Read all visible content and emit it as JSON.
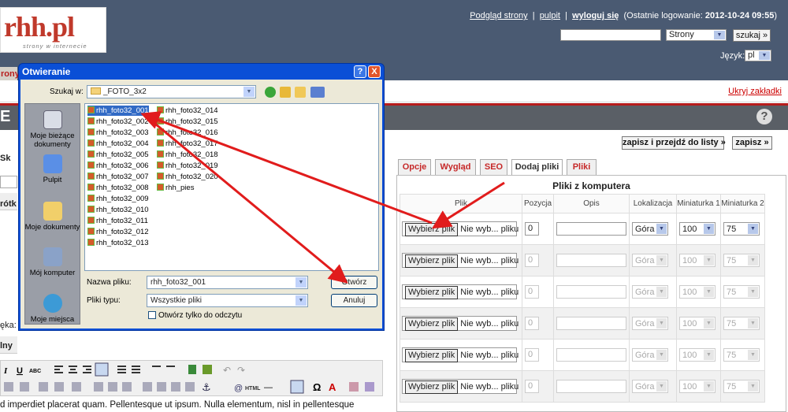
{
  "logo": {
    "text": "rhh.pl",
    "tagline": "strony w internecie"
  },
  "header": {
    "preview_link": "Podgląd strony",
    "desktop_link": "pulpit",
    "logout_link": "wyloguj się",
    "last_login_label": "(Ostatnie logowanie:",
    "last_login_value": "2012-10-24 09:55",
    "last_login_close": ")",
    "search_select": "Strony",
    "search_button": "szukaj »",
    "language_label": "Język:",
    "language_value": "pl",
    "separator": "|"
  },
  "nav": {
    "strony_tab": "rony",
    "hide_tabs": "Ukryj zakładki",
    "section_title": "E"
  },
  "actions": {
    "save_and_list": "zapisz i przejdź do listy »",
    "save": "zapisz »"
  },
  "tabs": [
    {
      "label": "Opcje",
      "active": false
    },
    {
      "label": "Wygląd",
      "active": false
    },
    {
      "label": "SEO",
      "active": false
    },
    {
      "label": "Dodaj pliki",
      "active": true
    },
    {
      "label": "Pliki",
      "active": false
    }
  ],
  "upload": {
    "title": "Pliki z komputera",
    "columns": [
      "Plik",
      "Pozycja",
      "Opis",
      "Lokalizacja",
      "Miniaturka 1",
      "Miniaturka 2"
    ],
    "choose_button": "Wybierz plik",
    "no_file_text": "Nie wyb... pliku",
    "rows": [
      {
        "position": "0",
        "location": "Góra",
        "thumb1": "100",
        "thumb2": "75",
        "enabled": true
      },
      {
        "position": "0",
        "location": "Góra",
        "thumb1": "100",
        "thumb2": "75",
        "enabled": false
      },
      {
        "position": "0",
        "location": "Góra",
        "thumb1": "100",
        "thumb2": "75",
        "enabled": false
      },
      {
        "position": "0",
        "location": "Góra",
        "thumb1": "100",
        "thumb2": "75",
        "enabled": false
      },
      {
        "position": "0",
        "location": "Góra",
        "thumb1": "100",
        "thumb2": "75",
        "enabled": false
      },
      {
        "position": "0",
        "location": "Góra",
        "thumb1": "100",
        "thumb2": "75",
        "enabled": false
      }
    ]
  },
  "left": {
    "label_1": "Sk",
    "label_2": "rótk",
    "label_3": "ęka: p",
    "label_4": "lny",
    "body_text": "d imperdiet placerat quam. Pellentesque ut ipsum. Nulla elementum, nisl in pellentesque"
  },
  "dialog": {
    "title": "Otwieranie",
    "look_in_label": "Szukaj w:",
    "look_in_value": "_FOTO_3x2",
    "places": [
      "Moje bieżące dokumenty",
      "Pulpit",
      "Moje dokumenty",
      "Mój komputer",
      "Moje miejsca"
    ],
    "files": [
      "rhh_foto32_001",
      "rhh_foto32_002",
      "rhh_foto32_003",
      "rhh_foto32_004",
      "rhh_foto32_005",
      "rhh_foto32_006",
      "rhh_foto32_007",
      "rhh_foto32_008",
      "rhh_foto32_009",
      "rhh_foto32_010",
      "rhh_foto32_011",
      "rhh_foto32_012",
      "rhh_foto32_013",
      "rhh_foto32_014",
      "rhh_foto32_015",
      "rhh_foto32_016",
      "rhh_foto32_017",
      "rhh_foto32_018",
      "rhh_foto32_019",
      "rhh_foto32_020",
      "rhh_pies"
    ],
    "filename_label": "Nazwa pliku:",
    "filename_value": "rhh_foto32_001",
    "filetype_label": "Pliki typu:",
    "filetype_value": "Wszystkie pliki",
    "readonly_label": "Otwórz tylko do odczytu",
    "open_button": "Otwórz",
    "cancel_button": "Anuluj",
    "help_button": "?",
    "close_button": "X"
  },
  "colors": {
    "accent": "#b71c1c",
    "header_bg": "#4a5a72",
    "dialog_blue": "#0a4fd6",
    "arrow": "#e11c1c"
  }
}
